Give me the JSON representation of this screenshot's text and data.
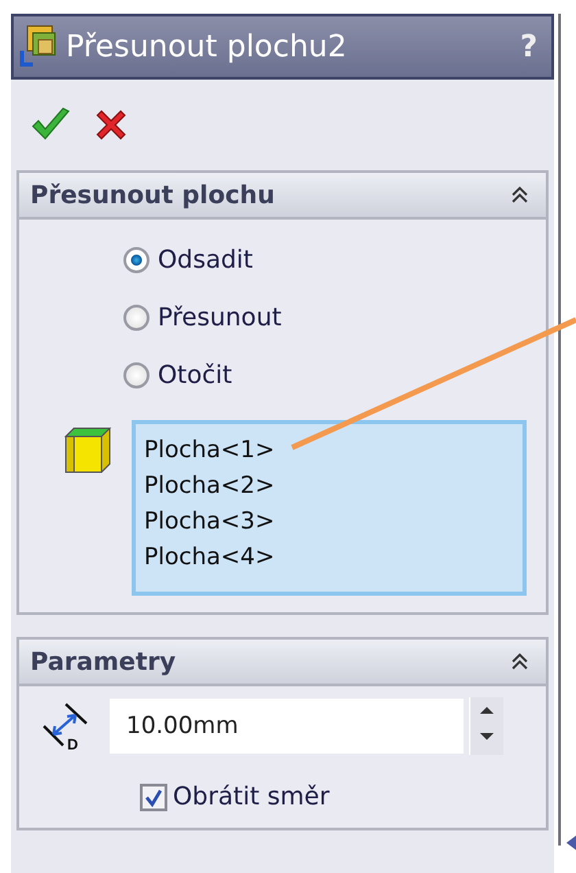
{
  "window": {
    "title": "Přesunout plochu2",
    "help": "?"
  },
  "sections": [
    {
      "title": "Přesunout plochu",
      "expanded": true,
      "kind": "faces",
      "options": [
        {
          "label": "Odsadit",
          "selected": true
        },
        {
          "label": "Přesunout",
          "selected": false
        },
        {
          "label": "Otočit",
          "selected": false
        }
      ],
      "faces": [
        "Plocha<1>",
        "Plocha<2>",
        "Plocha<3>",
        "Plocha<4>"
      ]
    },
    {
      "title": "Parametry",
      "expanded": true,
      "kind": "params",
      "icon_label": "D",
      "distance": "10.00mm",
      "reverse": {
        "label": "Obrátit směr",
        "checked": true
      }
    }
  ]
}
